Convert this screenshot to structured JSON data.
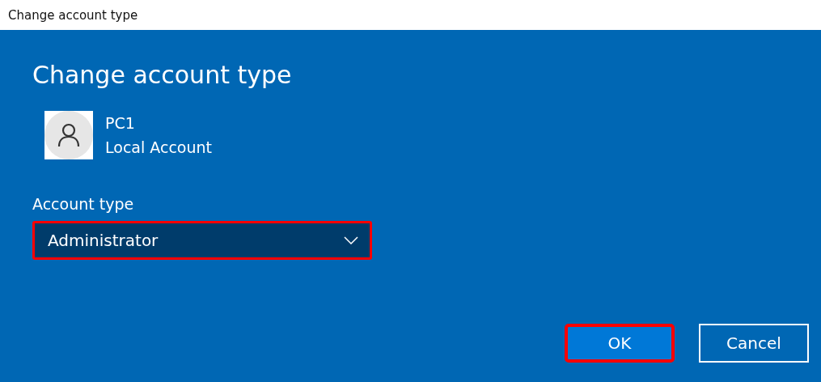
{
  "window": {
    "title": "Change account type"
  },
  "heading": "Change account type",
  "account": {
    "name": "PC1",
    "type": "Local Account"
  },
  "account_type": {
    "label": "Account type",
    "value": "Administrator",
    "highlighted": true
  },
  "buttons": [
    {
      "label": "OK",
      "kind": "primary",
      "highlighted": true
    },
    {
      "label": "Cancel",
      "kind": "secondary",
      "highlighted": false
    }
  ]
}
